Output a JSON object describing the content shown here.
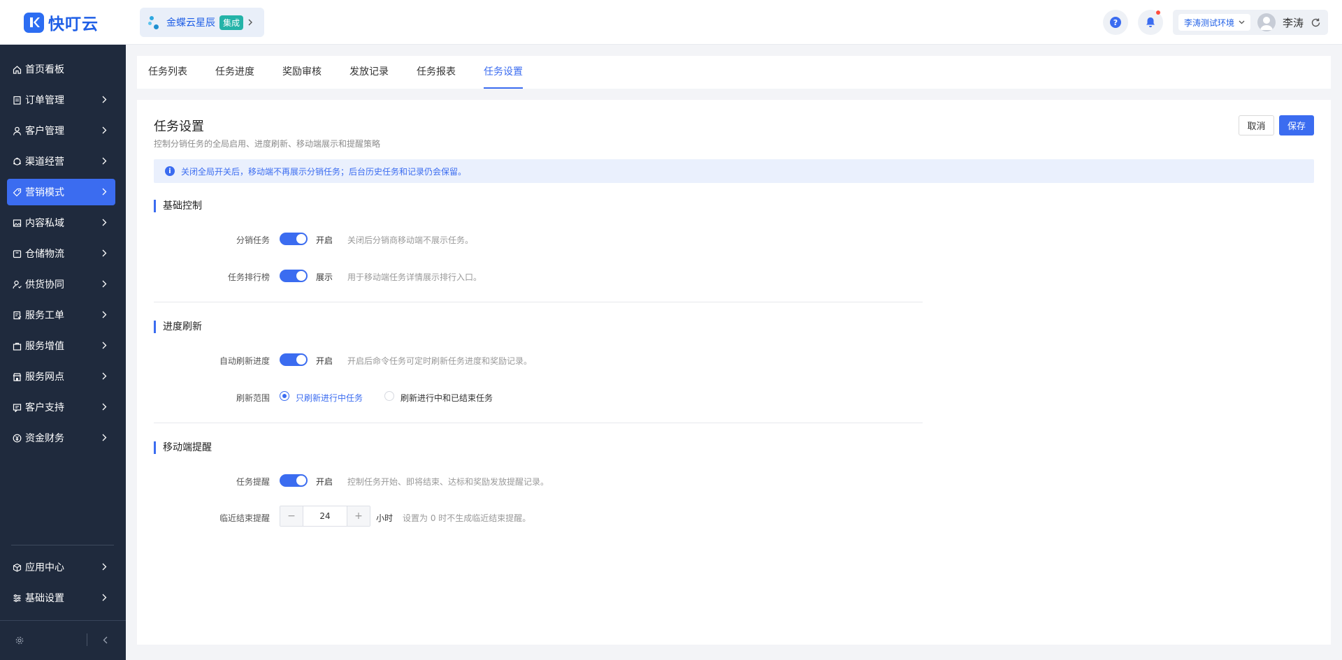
{
  "app": {
    "logo_text": "快叮云",
    "brand": {
      "name": "金蝶云星辰",
      "badge": "集成"
    },
    "env": "李涛测试环境",
    "user_name": "李涛"
  },
  "sidebar": {
    "items": [
      {
        "label": "首页看板",
        "icon": "home-icon"
      },
      {
        "label": "订单管理",
        "icon": "clipboard-icon"
      },
      {
        "label": "客户管理",
        "icon": "user-icon"
      },
      {
        "label": "渠道经营",
        "icon": "channel-icon"
      },
      {
        "label": "营销模式",
        "icon": "tag-icon"
      },
      {
        "label": "内容私域",
        "icon": "image-icon"
      },
      {
        "label": "仓储物流",
        "icon": "box-icon"
      },
      {
        "label": "供货协同",
        "icon": "supply-icon"
      },
      {
        "label": "服务工单",
        "icon": "ticket-icon"
      },
      {
        "label": "服务增值",
        "icon": "bag-icon"
      },
      {
        "label": "服务网点",
        "icon": "store-icon"
      },
      {
        "label": "客户支持",
        "icon": "support-icon"
      },
      {
        "label": "资金财务",
        "icon": "yen-icon"
      }
    ],
    "bottom_items": [
      {
        "label": "应用中心",
        "icon": "cube-icon"
      },
      {
        "label": "基础设置",
        "icon": "sliders-icon"
      }
    ]
  },
  "tabs": [
    "任务列表",
    "任务进度",
    "奖励审核",
    "发放记录",
    "任务报表",
    "任务设置"
  ],
  "page": {
    "title": "任务设置",
    "subtitle": "控制分销任务的全局启用、进度刷新、移动端展示和提醒策略",
    "cancel": "取消",
    "save": "保存",
    "notice": "关闭全局开关后，移动端不再展示分销任务；后台历史任务和记录仍会保留。"
  },
  "sections": {
    "basic": {
      "title": "基础控制",
      "distribution": {
        "label": "分销任务",
        "state": "开启",
        "hint": "关闭后分销商移动端不展示任务。"
      },
      "ranking": {
        "label": "任务排行榜",
        "state": "展示",
        "hint": "用于移动端任务详情展示排行入口。"
      }
    },
    "progress": {
      "title": "进度刷新",
      "auto": {
        "label": "自动刷新进度",
        "state": "开启",
        "hint": "开启后命令任务可定时刷新任务进度和奖励记录。"
      },
      "scope": {
        "label": "刷新范围",
        "option1": "只刷新进行中任务",
        "option2": "刷新进行中和已结束任务"
      }
    },
    "mobile": {
      "title": "移动端提醒",
      "remind": {
        "label": "任务提醒",
        "state": "开启",
        "hint": "控制任务开始、即将结束、达标和奖励发放提醒记录。"
      },
      "near_end": {
        "label": "临近结束提醒",
        "value": "24",
        "unit": "小时",
        "hint": "设置为 0 时不生成临近结束提醒。",
        "minus": "−",
        "plus": "+"
      }
    }
  }
}
